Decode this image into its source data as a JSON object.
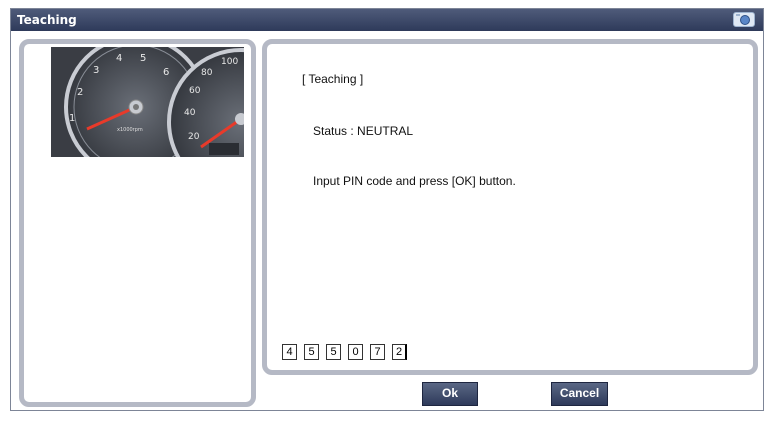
{
  "window": {
    "title": "Teaching",
    "title_icon": "camera-icon"
  },
  "image_panel": {
    "image": "instrument-cluster-gauges",
    "tach_labels": [
      "1",
      "2",
      "3",
      "4",
      "5",
      "6"
    ],
    "tach_unit": "x1000rpm",
    "speed_labels": [
      "20",
      "40",
      "60",
      "80",
      "100"
    ]
  },
  "message_panel": {
    "title": "[ Teaching ]",
    "status": "Status : NEUTRAL",
    "instruction": "Input PIN code and press [OK] button."
  },
  "pin": {
    "digits": [
      "4",
      "5",
      "5",
      "0",
      "7",
      "2"
    ]
  },
  "buttons": {
    "ok_label": "Ok",
    "cancel_label": "Cancel"
  },
  "colors": {
    "titlebar": "#2e3a5a",
    "panel_border": "#b5b9c5",
    "button": "#3e4a6a"
  }
}
